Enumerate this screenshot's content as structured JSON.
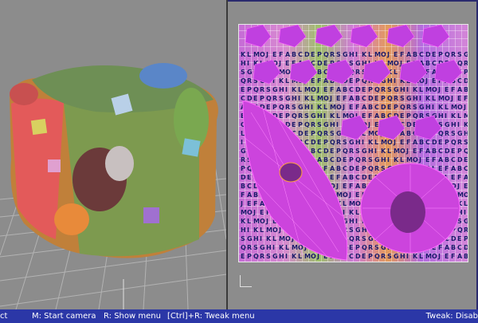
{
  "statusbar": {
    "items": [
      {
        "label": "ct"
      },
      {
        "label": "M: Start camera"
      },
      {
        "label": "R: Show menu"
      },
      {
        "label": "[Ctrl]+R: Tweak menu"
      }
    ],
    "tweak": "Tweak: Disab"
  },
  "uv_texture": {
    "letters": [
      "K",
      "L",
      "M",
      "O",
      "J",
      "E",
      "F",
      "A",
      "B",
      "C",
      "D",
      "E",
      "P",
      "Q",
      "R",
      "S",
      "G",
      "H",
      "I"
    ]
  },
  "colors": {
    "statusbar_bg": "#2b37a7",
    "uv_wire": "#ff44ff",
    "grid_line": "#b5b5b5"
  }
}
